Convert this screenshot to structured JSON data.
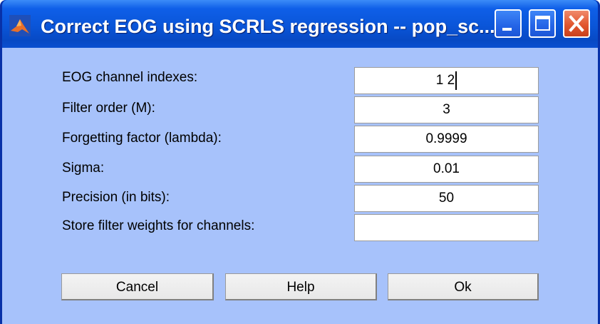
{
  "window": {
    "title": "Correct EOG using SCRLS regression -- pop_sc...",
    "icon": "matlab-icon",
    "controls": {
      "minimize": "minimize-icon",
      "maximize": "maximize-icon",
      "close": "close-icon"
    }
  },
  "form": {
    "rows": [
      {
        "label": "EOG channel indexes:",
        "value": "1 2"
      },
      {
        "label": "Filter order (M):",
        "value": "3"
      },
      {
        "label": "Forgetting factor (lambda):",
        "value": "0.9999"
      },
      {
        "label": "Sigma:",
        "value": "0.01"
      },
      {
        "label": "Precision (in bits):",
        "value": "50"
      },
      {
        "label": "Store filter weights for channels:",
        "value": ""
      }
    ]
  },
  "buttons": {
    "cancel": "Cancel",
    "help": "Help",
    "ok": "Ok"
  },
  "colors": {
    "client_bg": "#a7c2fb",
    "titlebar": "#0a55d8",
    "close_button": "#e2572f"
  }
}
